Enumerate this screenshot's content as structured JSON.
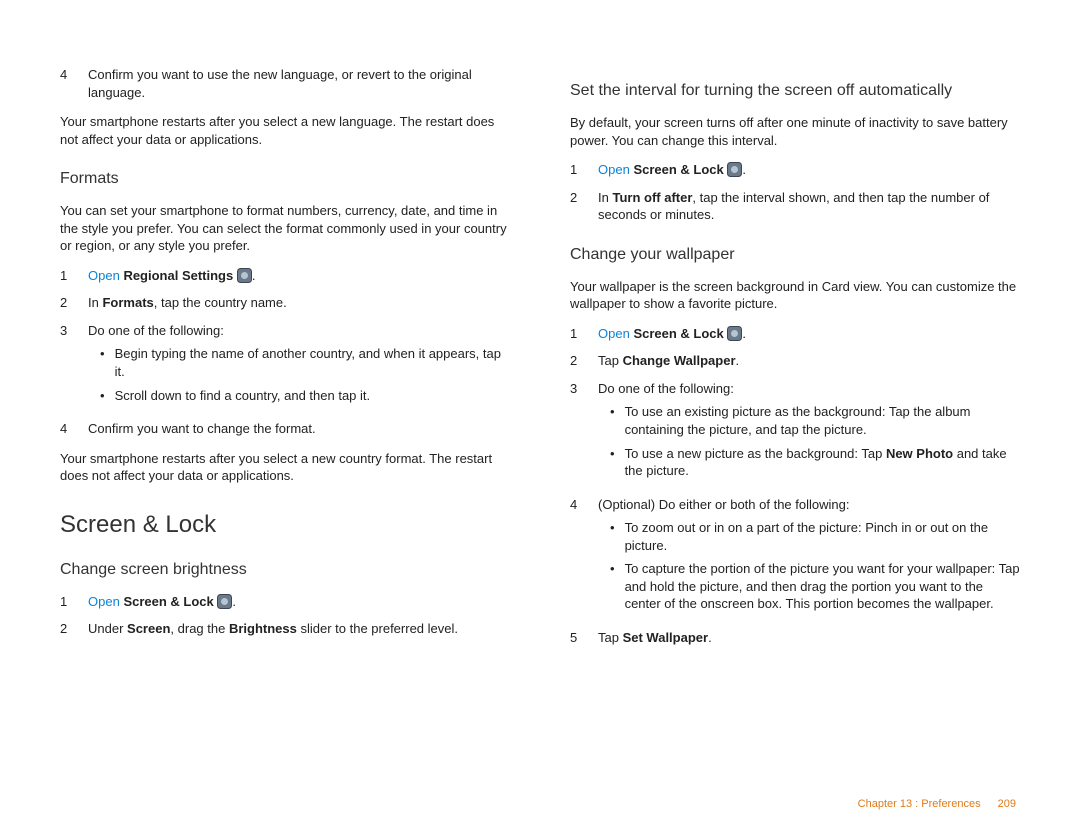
{
  "footer": {
    "chapter": "Chapter 13 : Preferences",
    "page": "209"
  },
  "left": {
    "continued_step4": {
      "num": "4",
      "text_before": "Confirm you want to use the new language, or revert to the original language."
    },
    "restart_note": "Your smartphone restarts after you select a new language. The restart does not affect your data or applications.",
    "formats": {
      "heading": "Formats",
      "intro": "You can set your smartphone to format numbers, currency, date, and time in the style you prefer. You can select the format commonly used in your country or region, or any style you prefer.",
      "steps": [
        {
          "num": "1",
          "parts": [
            {
              "t": "link",
              "v": "Open"
            },
            " ",
            {
              "t": "b",
              "v": "Regional Settings"
            },
            " ",
            {
              "t": "icon",
              "v": "regional-settings-icon"
            },
            "."
          ]
        },
        {
          "num": "2",
          "parts": [
            "In ",
            {
              "t": "b",
              "v": "Formats"
            },
            ", tap the country name."
          ]
        },
        {
          "num": "3",
          "parts": [
            "Do one of the following:"
          ],
          "bullets": [
            "Begin typing the name of another country, and when it appears, tap it.",
            "Scroll down to find a country, and then tap it."
          ]
        },
        {
          "num": "4",
          "parts": [
            "Confirm you want to change the format."
          ]
        }
      ],
      "restart_note": "Your smartphone restarts after you select a new country format. The restart does not affect your data or applications."
    },
    "screenlock_h1": "Screen & Lock",
    "brightness": {
      "heading": "Change screen brightness",
      "steps": [
        {
          "num": "1",
          "parts": [
            {
              "t": "link",
              "v": "Open"
            },
            " ",
            {
              "t": "b",
              "v": "Screen & Lock"
            },
            " ",
            {
              "t": "icon",
              "v": "screen-lock-icon"
            },
            "."
          ]
        },
        {
          "num": "2",
          "parts": [
            "Under ",
            {
              "t": "b",
              "v": "Screen"
            },
            ", drag the ",
            {
              "t": "b",
              "v": "Brightness"
            },
            " slider to the preferred level."
          ]
        }
      ]
    }
  },
  "right": {
    "auto_off": {
      "heading": "Set the interval for turning the screen off automatically",
      "intro": "By default, your screen turns off after one minute of inactivity to save battery power. You can change this interval.",
      "steps": [
        {
          "num": "1",
          "parts": [
            {
              "t": "link",
              "v": "Open"
            },
            " ",
            {
              "t": "b",
              "v": "Screen & Lock"
            },
            " ",
            {
              "t": "icon",
              "v": "screen-lock-icon"
            },
            "."
          ]
        },
        {
          "num": "2",
          "parts": [
            "In ",
            {
              "t": "b",
              "v": "Turn off after"
            },
            ", tap the interval shown, and then tap the number of seconds or minutes."
          ]
        }
      ]
    },
    "wallpaper": {
      "heading": "Change your wallpaper",
      "intro": "Your wallpaper is the screen background in Card view. You can customize the wallpaper to show a favorite picture.",
      "steps": [
        {
          "num": "1",
          "parts": [
            {
              "t": "link",
              "v": "Open"
            },
            " ",
            {
              "t": "b",
              "v": "Screen & Lock"
            },
            " ",
            {
              "t": "icon",
              "v": "screen-lock-icon"
            },
            "."
          ]
        },
        {
          "num": "2",
          "parts": [
            "Tap ",
            {
              "t": "b",
              "v": "Change Wallpaper"
            },
            "."
          ]
        },
        {
          "num": "3",
          "parts": [
            "Do one of the following:"
          ],
          "bullets": [
            [
              "To use an existing picture as the background: Tap the album containing the picture, and tap the picture."
            ],
            [
              "To use a new picture as the background: Tap ",
              {
                "t": "b",
                "v": "New Photo"
              },
              " and take the picture."
            ]
          ]
        },
        {
          "num": "4",
          "parts": [
            "(Optional) Do either or both of the following:"
          ],
          "bullets": [
            [
              "To zoom out or in on a part of the picture: Pinch in or out on the picture."
            ],
            [
              "To capture the portion of the picture you want for your wallpaper: Tap and hold the picture, and then drag the portion you want to the center of the onscreen box. This portion becomes the wallpaper."
            ]
          ]
        },
        {
          "num": "5",
          "parts": [
            "Tap ",
            {
              "t": "b",
              "v": "Set Wallpaper"
            },
            "."
          ]
        }
      ]
    }
  }
}
